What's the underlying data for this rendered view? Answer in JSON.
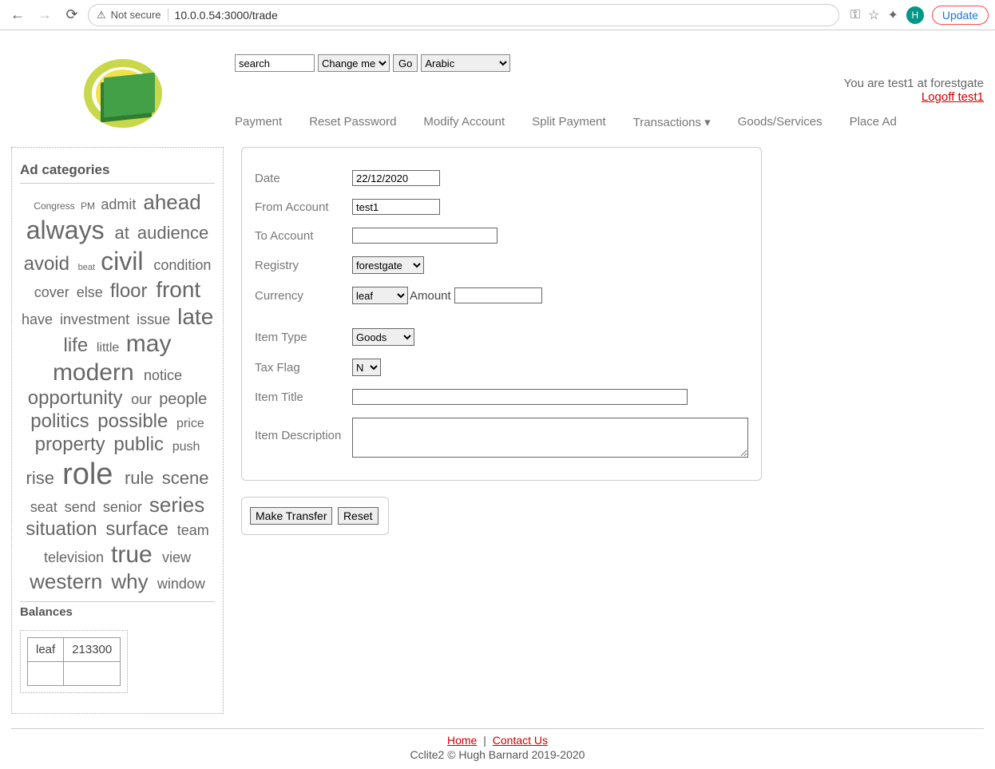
{
  "browser": {
    "not_secure_label": "Not secure",
    "url": "10.0.0.54:3000/trade",
    "avatar_letter": "H",
    "update_label": "Update"
  },
  "header": {
    "search_value": "search",
    "mode_select": "Change me",
    "go_label": "Go",
    "lang_select": "Arabic",
    "user_line": "You are test1 at forestgate",
    "logoff_label": "Logoff test1"
  },
  "nav": {
    "payment": "Payment",
    "reset_pw": "Reset Password",
    "modify_acct": "Modify Account",
    "split_pay": "Split Payment",
    "transactions": "Transactions ▾",
    "goods": "Goods/Services",
    "place_ad": "Place Ad"
  },
  "sidebar": {
    "title": "Ad categories",
    "tags": [
      {
        "t": "Congress",
        "s": 12
      },
      {
        "t": "PM",
        "s": 12
      },
      {
        "t": "admit",
        "s": 18
      },
      {
        "t": "ahead",
        "s": 26
      },
      {
        "t": "always",
        "s": 32
      },
      {
        "t": "at",
        "s": 22
      },
      {
        "t": "audience",
        "s": 22
      },
      {
        "t": "avoid",
        "s": 24
      },
      {
        "t": "beat",
        "s": 11
      },
      {
        "t": "civil",
        "s": 32
      },
      {
        "t": "condition",
        "s": 18
      },
      {
        "t": "cover",
        "s": 18
      },
      {
        "t": "else",
        "s": 18
      },
      {
        "t": "floor",
        "s": 24
      },
      {
        "t": "front",
        "s": 28
      },
      {
        "t": "have",
        "s": 18
      },
      {
        "t": "investment",
        "s": 18
      },
      {
        "t": "issue",
        "s": 18
      },
      {
        "t": "late",
        "s": 28
      },
      {
        "t": "life",
        "s": 24
      },
      {
        "t": "little",
        "s": 16
      },
      {
        "t": "may",
        "s": 30
      },
      {
        "t": "modern",
        "s": 30
      },
      {
        "t": "notice",
        "s": 18
      },
      {
        "t": "opportunity",
        "s": 24
      },
      {
        "t": "our",
        "s": 18
      },
      {
        "t": "people",
        "s": 20
      },
      {
        "t": "politics",
        "s": 24
      },
      {
        "t": "possible",
        "s": 24
      },
      {
        "t": "price",
        "s": 16
      },
      {
        "t": "property",
        "s": 24
      },
      {
        "t": "public",
        "s": 24
      },
      {
        "t": "push",
        "s": 16
      },
      {
        "t": "rise",
        "s": 22
      },
      {
        "t": "role",
        "s": 38
      },
      {
        "t": "rule",
        "s": 22
      },
      {
        "t": "scene",
        "s": 22
      },
      {
        "t": "seat",
        "s": 18
      },
      {
        "t": "send",
        "s": 18
      },
      {
        "t": "senior",
        "s": 18
      },
      {
        "t": "series",
        "s": 26
      },
      {
        "t": "situation",
        "s": 24
      },
      {
        "t": "surface",
        "s": 24
      },
      {
        "t": "team",
        "s": 18
      },
      {
        "t": "television",
        "s": 18
      },
      {
        "t": "true",
        "s": 30
      },
      {
        "t": "view",
        "s": 18
      },
      {
        "t": "western",
        "s": 26
      },
      {
        "t": "why",
        "s": 26
      },
      {
        "t": "window",
        "s": 18
      }
    ],
    "balances_title": "Balances",
    "bal_currency": "leaf",
    "bal_amount": "213300"
  },
  "form": {
    "date_label": "Date",
    "date_value": "22/12/2020",
    "from_label": "From Account",
    "from_value": "test1",
    "to_label": "To Account",
    "to_value": "",
    "registry_label": "Registry",
    "registry_value": "forestgate",
    "currency_label": "Currency",
    "currency_value": "leaf",
    "amount_label": "Amount",
    "amount_value": "",
    "itemtype_label": "Item Type",
    "itemtype_value": "Goods",
    "taxflag_label": "Tax Flag",
    "taxflag_value": "N",
    "itemtitle_label": "Item Title",
    "itemtitle_value": "",
    "itemdesc_label": "Item Description",
    "itemdesc_value": "",
    "submit_label": "Make Transfer",
    "reset_label": "Reset"
  },
  "footer": {
    "home": "Home",
    "contact": "Contact Us",
    "copy": "Cclite2 © Hugh Barnard 2019-2020"
  }
}
